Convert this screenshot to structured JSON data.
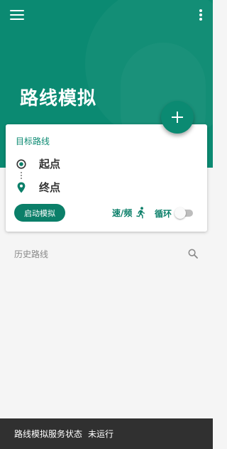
{
  "header": {
    "title": "路线模拟",
    "menu_icon": "menu-icon",
    "more_icon": "more-vert-icon",
    "background_color": "#0b8a72"
  },
  "fab": {
    "icon": "plus-icon"
  },
  "route_card": {
    "title": "目标路线",
    "start_label": "起点",
    "end_label": "终点",
    "start_icon": "radio-target-icon",
    "end_icon": "location-pin-icon",
    "start_button_label": "启动模拟",
    "speed_label": "速/频",
    "speed_icon": "running-person-icon",
    "loop_label": "循环",
    "loop_enabled": false
  },
  "history": {
    "label": "历史路线",
    "search_icon": "search-icon"
  },
  "status_bar": {
    "label": "路线模拟服务状态",
    "value": "未运行"
  },
  "colors": {
    "accent": "#0b8a72",
    "status_bar": "#303030",
    "background": "#f5f5f5"
  }
}
